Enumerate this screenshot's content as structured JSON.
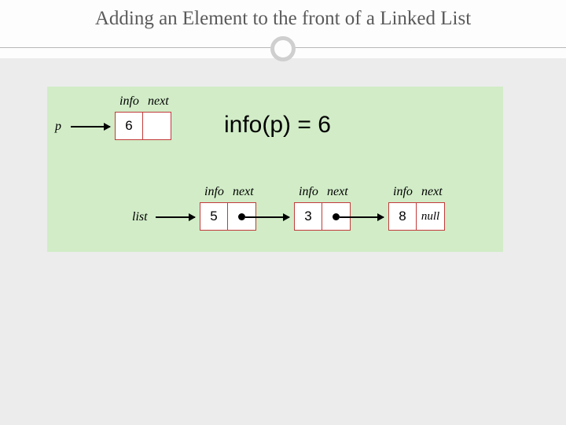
{
  "title": "Adding an Element to the front of a Linked List",
  "equation": "info(p) = 6",
  "labels": {
    "info": "info",
    "next": "next",
    "null": "null"
  },
  "pointers": {
    "p": "p",
    "list": "list"
  },
  "nodes": {
    "p": {
      "info": "6",
      "next": ""
    },
    "n1": {
      "info": "5"
    },
    "n2": {
      "info": "3"
    },
    "n3": {
      "info": "8"
    }
  }
}
